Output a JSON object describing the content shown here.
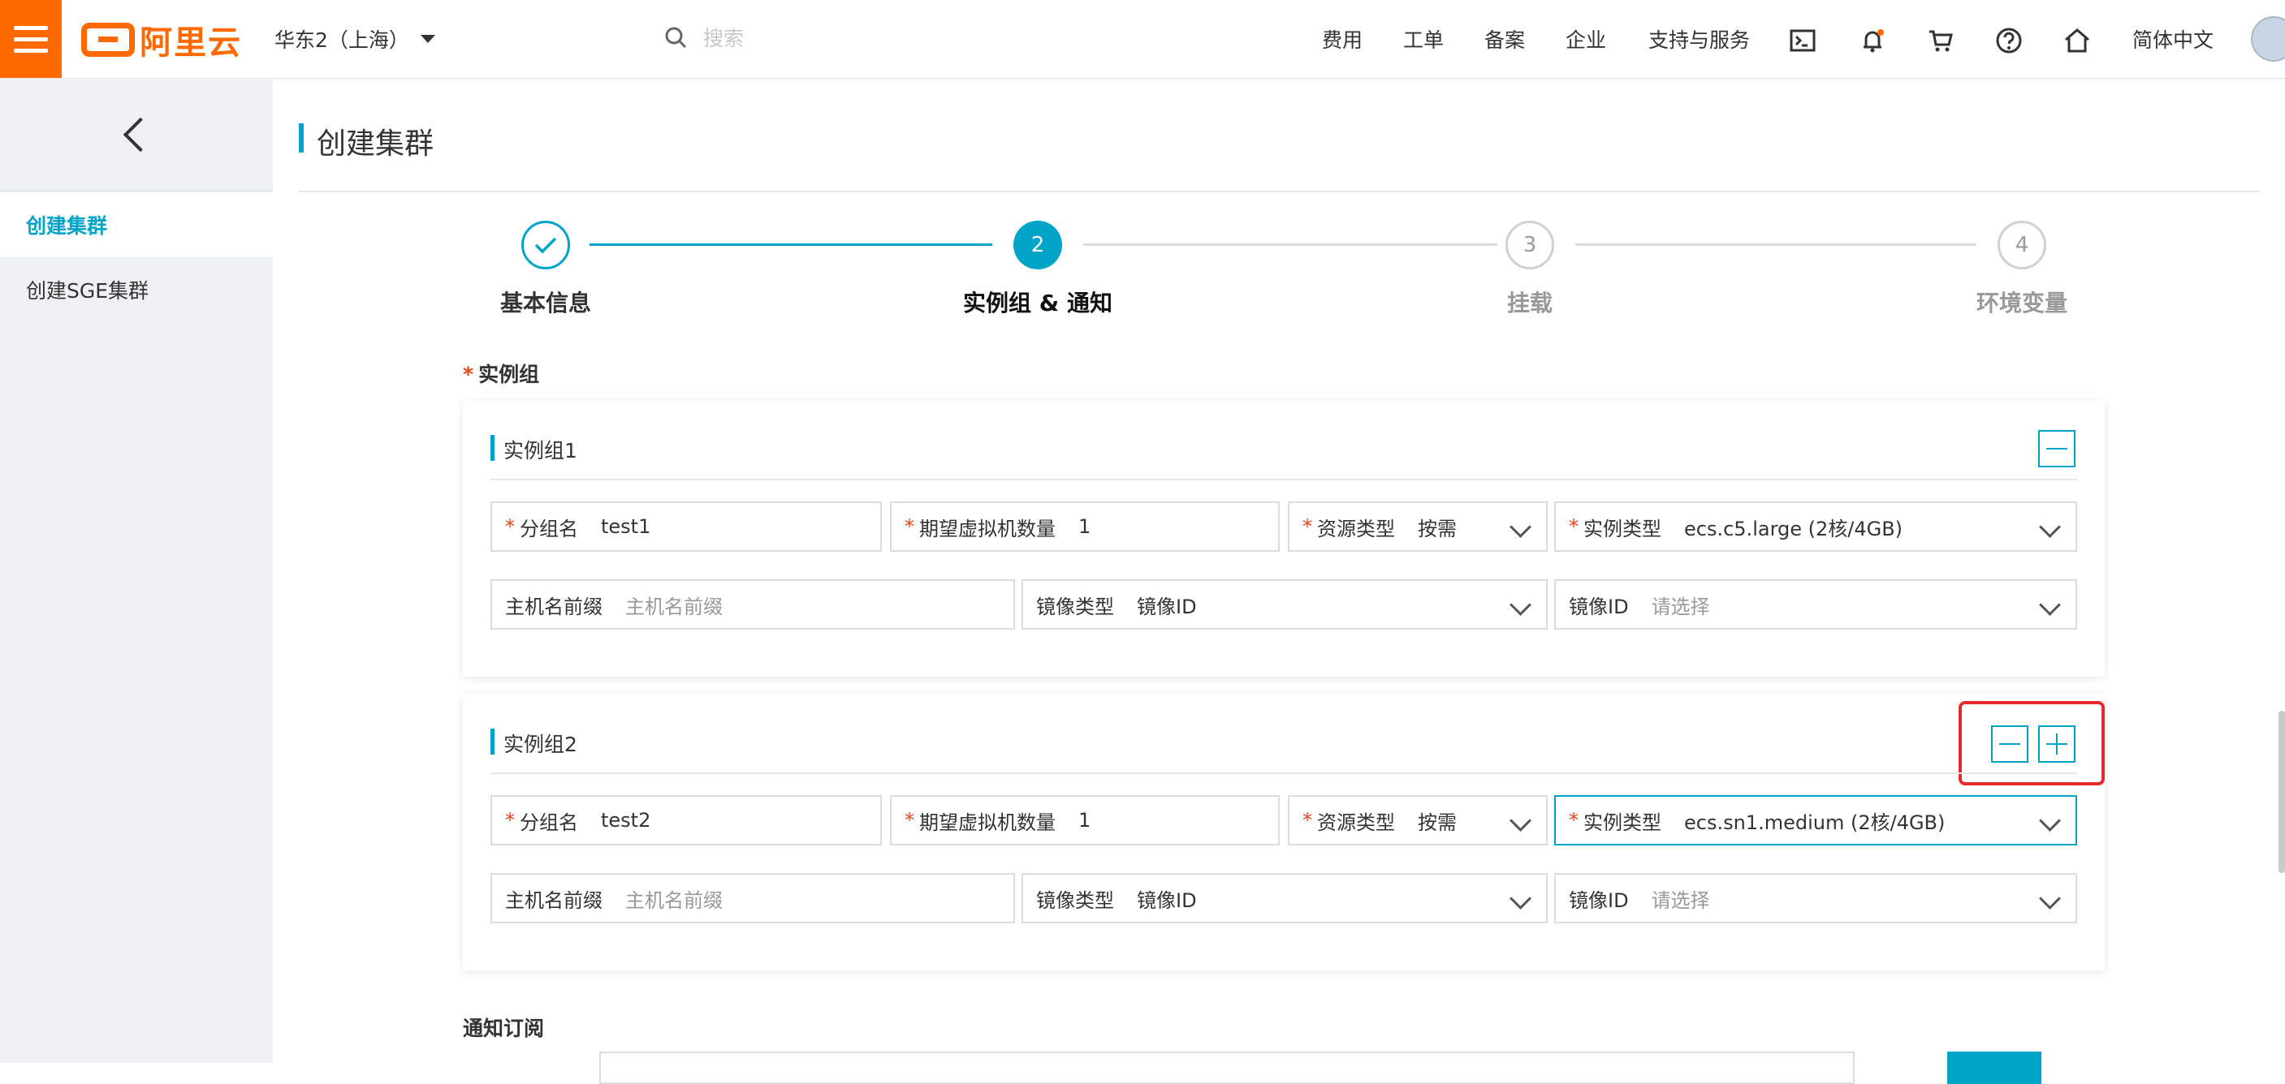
{
  "header": {
    "logo_text": "阿里云",
    "region": "华东2（上海）",
    "search_placeholder": "搜索",
    "nav": [
      "费用",
      "工单",
      "备案",
      "企业",
      "支持与服务"
    ],
    "language": "简体中文",
    "icons": [
      "terminal-icon",
      "bell-icon",
      "cart-icon",
      "help-icon",
      "home-icon"
    ],
    "accent_color": "#ff6a00"
  },
  "sidebar": {
    "items": [
      {
        "label": "创建集群",
        "active": true
      },
      {
        "label": "创建SGE集群",
        "active": false
      }
    ]
  },
  "page": {
    "title": "创建集群",
    "accent_color": "#00a4c9"
  },
  "steps": [
    {
      "label": "基本信息",
      "num": "",
      "state": "done"
    },
    {
      "label": "实例组 & 通知",
      "num": "2",
      "state": "current"
    },
    {
      "label": "挂载",
      "num": "3",
      "state": "pending"
    },
    {
      "label": "环境变量",
      "num": "4",
      "state": "pending"
    }
  ],
  "instance_section": {
    "label": "实例组"
  },
  "groups": [
    {
      "title": "实例组1",
      "row1": [
        {
          "label": "分组名",
          "value": "test1"
        },
        {
          "label": "期望虚拟机数量",
          "value": "1"
        },
        {
          "label": "资源类型",
          "value": "按需"
        },
        {
          "label": "实例类型",
          "value": "ecs.c5.large (2核/4GB)"
        }
      ],
      "row2": [
        {
          "label": "主机名前缀",
          "placeholder": "主机名前缀"
        },
        {
          "label": "镜像类型",
          "value": "镜像ID"
        },
        {
          "label": "镜像ID",
          "placeholder": "请选择"
        }
      ]
    },
    {
      "title": "实例组2",
      "row1": [
        {
          "label": "分组名",
          "value": "test2"
        },
        {
          "label": "期望虚拟机数量",
          "value": "1"
        },
        {
          "label": "资源类型",
          "value": "按需"
        },
        {
          "label": "实例类型",
          "value": "ecs.sn1.medium (2核/4GB)"
        }
      ],
      "row2": [
        {
          "label": "主机名前缀",
          "placeholder": "主机名前缀"
        },
        {
          "label": "镜像类型",
          "value": "镜像ID"
        },
        {
          "label": "镜像ID",
          "placeholder": "请选择"
        }
      ]
    }
  ],
  "notify": {
    "label": "通知订阅"
  }
}
